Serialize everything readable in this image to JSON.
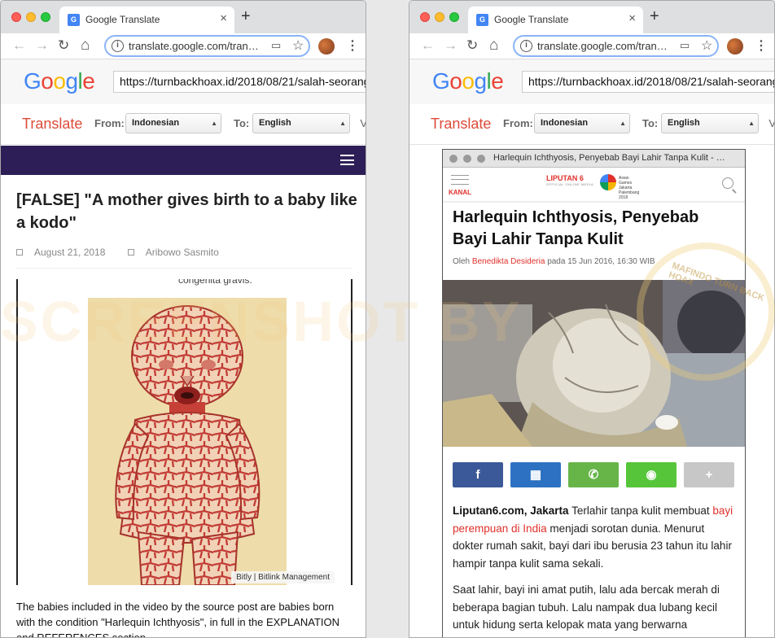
{
  "browser": {
    "tab_title": "Google Translate",
    "tab_close": "×",
    "new_tab": "+",
    "url": "translate.google.com/tran…",
    "back": "←",
    "forward": "→",
    "reload": "↻",
    "home": "⌂",
    "star": "☆",
    "menu": "⋮"
  },
  "translate_bar": {
    "logo": "Google",
    "source_url": "https://turnbackhoax.id/2018/08/21/salah-seorang",
    "translate_label": "Translate",
    "from_label": "From:",
    "from_value": "Indonesian",
    "to_label": "To:",
    "to_value": "English",
    "view_hint": "V"
  },
  "left_page": {
    "title": "[FALSE] \"A mother gives birth to a baby like a kodo\"",
    "date": "August 21, 2018",
    "author": "Aribowo Sasmito",
    "image_caption_top": "congenita gravis.",
    "image_credit": "Bitly | Bitlink Management",
    "body": "The babies included in the video by the source post are babies born with the condition \"Harlequin Ichthyosis\", in full in the EXPLANATION and REFERENCES section."
  },
  "right_page": {
    "inner_window_title": "Harlequin Ichthyosis, Penyebab Bayi Lahir Tanpa Kulit - …",
    "kanal": "KANAL",
    "brand": "LIPUTAN 6",
    "brand_sub": "OFFICIAL ONLINE MEDIA",
    "event": "Asian Games Jakarta Palembang 2018",
    "title": "Harlequin Ichthyosis, Penyebab Bayi Lahir Tanpa Kulit",
    "byline_prefix": "Oleh",
    "byline_author": "Benedikta Desideria",
    "byline_suffix": "pada 15 Jun 2016, 16:30 WIB",
    "share_buttons": [
      {
        "name": "facebook",
        "glyph": "f",
        "color": "#3b5998"
      },
      {
        "name": "bbm",
        "glyph": "▦",
        "color": "#2d72c2"
      },
      {
        "name": "whatsapp",
        "glyph": "✆",
        "color": "#67b548"
      },
      {
        "name": "line",
        "glyph": "◉",
        "color": "#56c53a"
      },
      {
        "name": "more",
        "glyph": "+",
        "color": "#c7c7c7"
      }
    ],
    "lead_bold": "Liputan6.com, Jakarta",
    "lead_text_1": " Terlahir tanpa kulit membuat ",
    "lead_link": "bayi perempuan di India",
    "lead_text_2": " menjadi sorotan dunia. Menurut dokter rumah sakit, bayi dari ibu berusia 23 tahun itu lahir hampir tanpa kulit sama sekali.",
    "paragraph_2": "Saat lahir, bayi ini amat putih, lalu ada bercak merah di beberapa bagian tubuh. Lalu nampak dua lubang kecil untuk hidung serta kelopak mata yang berwarna"
  },
  "watermark": "SCREENSHOT BY",
  "seal_text": "MAFINDO TURN BACK HOAX"
}
